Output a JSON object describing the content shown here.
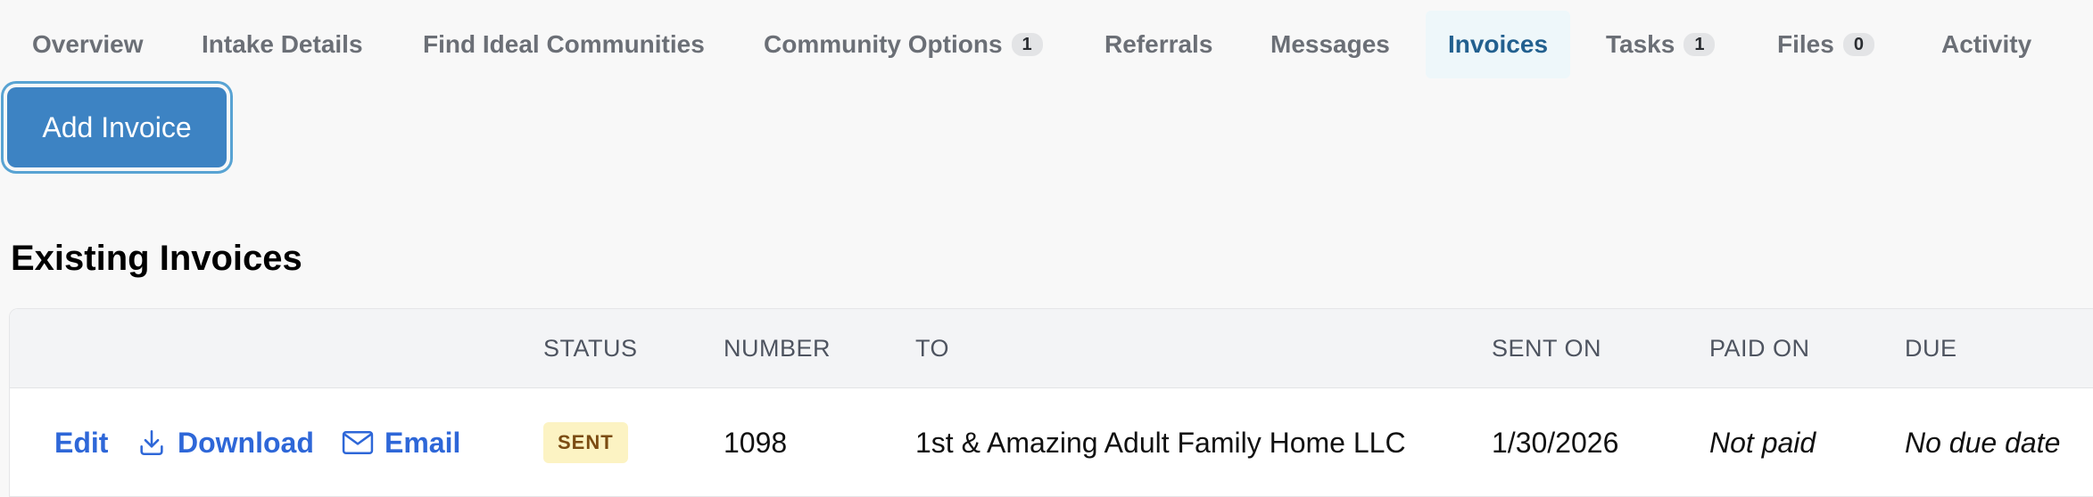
{
  "tabs": [
    {
      "label": "Overview"
    },
    {
      "label": "Intake Details"
    },
    {
      "label": "Find Ideal Communities"
    },
    {
      "label": "Community Options",
      "badge": "1"
    },
    {
      "label": "Referrals"
    },
    {
      "label": "Messages"
    },
    {
      "label": "Invoices",
      "active": true
    },
    {
      "label": "Tasks",
      "badge": "1"
    },
    {
      "label": "Files",
      "badge": "0"
    },
    {
      "label": "Activity"
    }
  ],
  "actions": {
    "add_invoice_label": "Add Invoice"
  },
  "section": {
    "title": "Existing Invoices"
  },
  "table": {
    "headers": {
      "status": "STATUS",
      "number": "NUMBER",
      "to": "TO",
      "sent_on": "SENT ON",
      "paid_on": "PAID ON",
      "due": "DUE"
    },
    "rows": [
      {
        "actions": {
          "edit": "Edit",
          "download": "Download",
          "email": "Email"
        },
        "status": "SENT",
        "number": "1098",
        "to": "1st & Amazing Adult Family Home LLC",
        "sent_on": "1/30/2026",
        "paid_on": "Not paid",
        "due": "No due date"
      }
    ]
  },
  "colors": {
    "accent": "#3d83c3",
    "link": "#2e67d8",
    "active_tab": "#22608f",
    "status_sent_bg": "#fcf3c3",
    "status_sent_text": "#7b4c12"
  },
  "icons": {
    "download": "download-icon",
    "email": "envelope-icon"
  }
}
